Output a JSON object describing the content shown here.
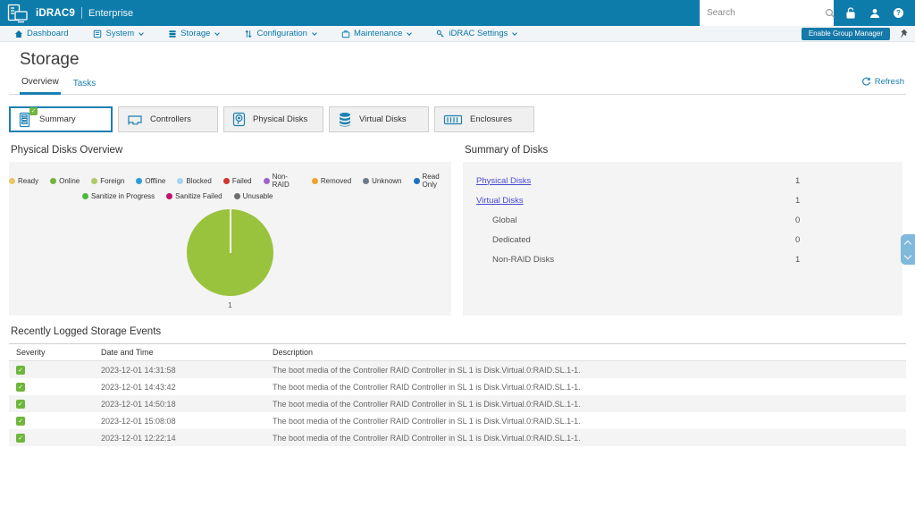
{
  "colors": {
    "topbar_bg": "#0E7CAB",
    "accent": "#1B80B2",
    "nav_link": "#0878A8",
    "content_link": "#4A4AD4",
    "ok_green": "#6FB63C",
    "panel_bg": "#F4F4F4",
    "scroll_widget": "#7FB9DC"
  },
  "icons": {
    "check_glyph": "✓",
    "help_glyph": "?"
  },
  "header": {
    "brand": "iDRAC9",
    "edition": "Enterprise",
    "search_placeholder": "Search"
  },
  "nav": {
    "items": [
      {
        "label": "Dashboard",
        "dropdown": false
      },
      {
        "label": "System",
        "dropdown": true
      },
      {
        "label": "Storage",
        "dropdown": true
      },
      {
        "label": "Configuration",
        "dropdown": true
      },
      {
        "label": "Maintenance",
        "dropdown": true
      },
      {
        "label": "iDRAC Settings",
        "dropdown": true
      }
    ],
    "enable_group_manager_label": "Enable Group Manager"
  },
  "page": {
    "title": "Storage",
    "tabs": [
      {
        "label": "Overview",
        "active": true
      },
      {
        "label": "Tasks",
        "active": false
      }
    ],
    "refresh_label": "Refresh"
  },
  "tiles": [
    {
      "label": "Summary",
      "active": true
    },
    {
      "label": "Controllers",
      "active": false
    },
    {
      "label": "Physical Disks",
      "active": false
    },
    {
      "label": "Virtual Disks",
      "active": false
    },
    {
      "label": "Enclosures",
      "active": false
    }
  ],
  "physical_disks_overview": {
    "heading": "Physical Disks Overview",
    "legend": [
      {
        "label": "Ready",
        "color": "#E8C660"
      },
      {
        "label": "Online",
        "color": "#72B43E"
      },
      {
        "label": "Foreign",
        "color": "#AFCB64"
      },
      {
        "label": "Offline",
        "color": "#2F9CD8"
      },
      {
        "label": "Blocked",
        "color": "#A3D5EE"
      },
      {
        "label": "Failed",
        "color": "#D2342E"
      },
      {
        "label": "Non-RAID",
        "color": "#A262C6"
      },
      {
        "label": "Removed",
        "color": "#F0A22E"
      },
      {
        "label": "Unknown",
        "color": "#6D7B8A"
      },
      {
        "label": "Read Only",
        "color": "#1E6FC4"
      },
      {
        "label": "Sanitize in Progress",
        "color": "#4EB83C"
      },
      {
        "label": "Sanitize Failed",
        "color": "#C0146E"
      },
      {
        "label": "Unusable",
        "color": "#6E6E6E"
      }
    ],
    "pie": {
      "value_label": "1",
      "color": "#99C33D"
    }
  },
  "chart_data": {
    "type": "pie",
    "title": "Physical Disks Overview",
    "slices": [
      {
        "label": "1",
        "value": 1,
        "color": "#99C33D",
        "fraction": 1.0
      }
    ],
    "data_label": "1",
    "legend_entries": [
      "Ready",
      "Online",
      "Foreign",
      "Offline",
      "Blocked",
      "Failed",
      "Non-RAID",
      "Removed",
      "Unknown",
      "Read Only",
      "Sanitize in Progress",
      "Sanitize Failed",
      "Unusable"
    ],
    "legend_position": "top"
  },
  "summary_of_disks": {
    "heading": "Summary of Disks",
    "rows": [
      {
        "label": "Physical Disks",
        "value": "1",
        "link": true,
        "indent": false
      },
      {
        "label": "Virtual Disks",
        "value": "1",
        "link": true,
        "indent": false
      },
      {
        "label": "Global",
        "value": "0",
        "link": false,
        "indent": true
      },
      {
        "label": "Dedicated",
        "value": "0",
        "link": false,
        "indent": true
      },
      {
        "label": "Non-RAID Disks",
        "value": "1",
        "link": false,
        "indent": true
      }
    ]
  },
  "events": {
    "heading": "Recently Logged Storage Events",
    "columns": [
      "Severity",
      "Date and Time",
      "Description"
    ],
    "rows": [
      {
        "severity": "ok",
        "datetime": "2023-12-01 14:31:58",
        "description": "The boot media of the Controller RAID Controller in SL 1 is Disk.Virtual.0:RAID.SL.1-1."
      },
      {
        "severity": "ok",
        "datetime": "2023-12-01 14:43:42",
        "description": "The boot media of the Controller RAID Controller in SL 1 is Disk.Virtual.0:RAID.SL.1-1."
      },
      {
        "severity": "ok",
        "datetime": "2023-12-01 14:50:18",
        "description": "The boot media of the Controller RAID Controller in SL 1 is Disk.Virtual.0:RAID.SL.1-1."
      },
      {
        "severity": "ok",
        "datetime": "2023-12-01 15:08:08",
        "description": "The boot media of the Controller RAID Controller in SL 1 is Disk.Virtual.0:RAID.SL.1-1."
      },
      {
        "severity": "ok",
        "datetime": "2023-12-01 12:22:14",
        "description": "The boot media of the Controller RAID Controller in SL 1 is Disk.Virtual.0:RAID.SL.1-1."
      }
    ]
  }
}
